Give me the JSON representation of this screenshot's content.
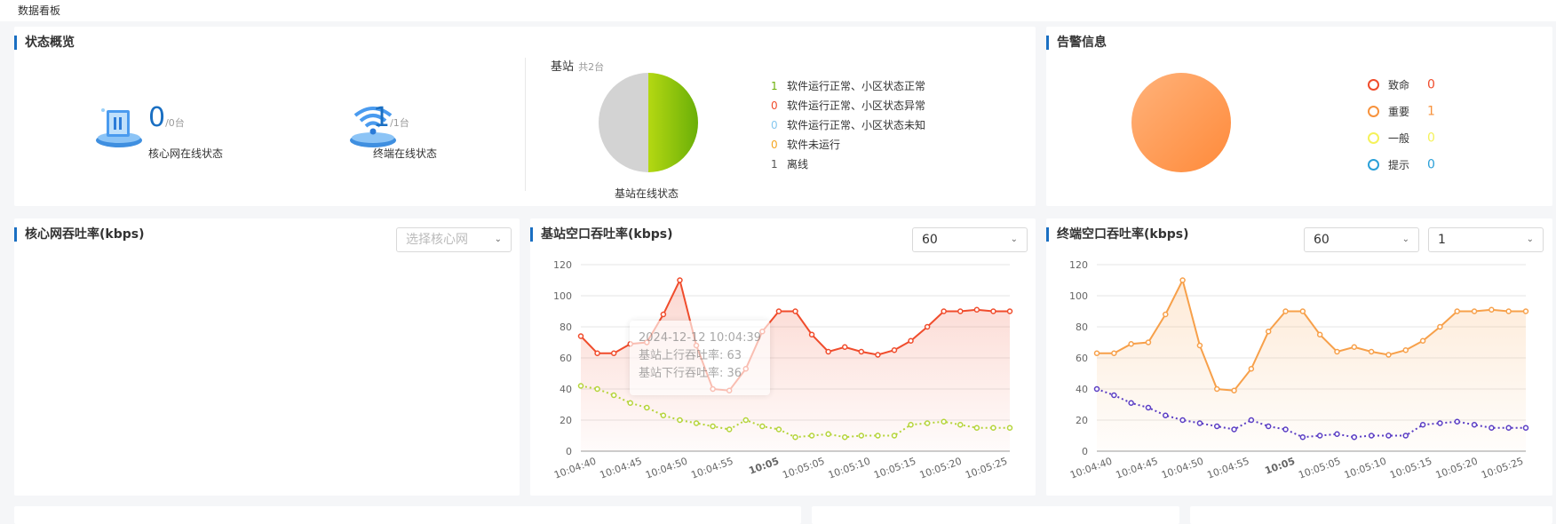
{
  "breadcrumb": "数据看板",
  "overview": {
    "title": "状态概览",
    "core": {
      "num": "0",
      "total": "/0台",
      "label": "核心网在线状态"
    },
    "terminal": {
      "num": "1",
      "total": "/1台",
      "label": "终端在线状态"
    },
    "base_title": "基站",
    "base_total": "共2台",
    "pie_caption": "基站在线状态",
    "legend": [
      {
        "count": "1",
        "label": "软件运行正常、小区状态正常",
        "color": "#6aaf08"
      },
      {
        "count": "0",
        "label": "软件运行正常、小区状态异常",
        "color": "#f04c2c"
      },
      {
        "count": "0",
        "label": "软件运行正常、小区状态未知",
        "color": "#86c8f0"
      },
      {
        "count": "0",
        "label": "软件未运行",
        "color": "#f5a623"
      },
      {
        "count": "1",
        "label": "离线",
        "color": "#555555"
      }
    ]
  },
  "alarm": {
    "title": "告警信息",
    "items": [
      {
        "label": "致命",
        "count": "0",
        "color": "#f04c2c"
      },
      {
        "label": "重要",
        "count": "1",
        "color": "#f7923c"
      },
      {
        "label": "一般",
        "count": "0",
        "color": "#f5f25a"
      },
      {
        "label": "提示",
        "count": "0",
        "color": "#2ba0d8"
      }
    ]
  },
  "core_throughput": {
    "title": "核心网吞吐率(kbps)",
    "select_placeholder": "选择核心网"
  },
  "base_throughput": {
    "title": "基站空口吞吐率(kbps)",
    "select_value": "60"
  },
  "terminal_throughput": {
    "title": "终端空口吞吐率(kbps)",
    "select1_value": "60",
    "select2_value": "1"
  },
  "tooltip": {
    "time": "2024-12-12 10:04:39",
    "up": "基站上行吞吐率: 63",
    "down": "基站下行吞吐率: 36"
  },
  "chart_data": [
    {
      "type": "area",
      "title": "基站空口吞吐率(kbps)",
      "ylim": [
        0,
        120
      ],
      "yticks": [
        0,
        20,
        40,
        60,
        80,
        100,
        120
      ],
      "xticks": [
        "10:04:40",
        "10:04:45",
        "10:04:50",
        "10:04:55",
        "10:05",
        "10:05:05",
        "10:05:10",
        "10:05:15",
        "10:05:20",
        "10:05:25"
      ],
      "x": [
        "10:04:37",
        "10:04:38",
        "10:04:39",
        "10:04:40",
        "10:04:41",
        "10:04:42",
        "10:04:43",
        "10:04:44",
        "10:04:45",
        "10:04:46",
        "10:04:47",
        "10:04:48",
        "10:04:49",
        "10:04:50",
        "10:04:51",
        "10:04:52",
        "10:04:53",
        "10:04:54",
        "10:04:55",
        "10:04:56",
        "10:04:57",
        "10:04:58",
        "10:04:59",
        "10:05:00",
        "10:05:01",
        "10:05:02",
        "10:05:03",
        "10:05:04",
        "10:05:05",
        "10:05:06"
      ],
      "series": [
        {
          "name": "基站上行吞吐率",
          "color": "#f04c2c",
          "values": [
            74,
            63,
            63,
            69,
            70,
            88,
            110,
            68,
            40,
            39,
            53,
            77,
            90,
            90,
            75,
            64,
            67,
            64,
            62,
            65,
            71,
            80,
            90,
            90,
            91,
            90,
            90
          ]
        },
        {
          "name": "基站下行吞吐率",
          "color": "#b5d43a",
          "values": [
            42,
            40,
            36,
            31,
            28,
            23,
            20,
            18,
            16,
            14,
            20,
            16,
            14,
            9,
            10,
            11,
            9,
            10,
            10,
            10,
            17,
            18,
            19,
            17,
            15,
            15,
            15
          ]
        }
      ]
    },
    {
      "type": "area",
      "title": "终端空口吞吐率(kbps)",
      "ylim": [
        0,
        120
      ],
      "yticks": [
        0,
        20,
        40,
        60,
        80,
        100,
        120
      ],
      "xticks": [
        "10:04:40",
        "10:04:45",
        "10:04:50",
        "10:04:55",
        "10:05",
        "10:05:05",
        "10:05:10",
        "10:05:15",
        "10:05:20",
        "10:05:25"
      ],
      "series": [
        {
          "color": "#f7a04a",
          "values": [
            63,
            63,
            69,
            70,
            88,
            110,
            68,
            40,
            39,
            53,
            77,
            90,
            90,
            75,
            64,
            67,
            64,
            62,
            65,
            71,
            80,
            90,
            90,
            91,
            90,
            90
          ]
        },
        {
          "color": "#5b3ec4",
          "values": [
            40,
            36,
            31,
            28,
            23,
            20,
            18,
            16,
            14,
            20,
            16,
            14,
            9,
            10,
            11,
            9,
            10,
            10,
            10,
            17,
            18,
            19,
            17,
            15,
            15,
            15
          ]
        }
      ]
    }
  ]
}
